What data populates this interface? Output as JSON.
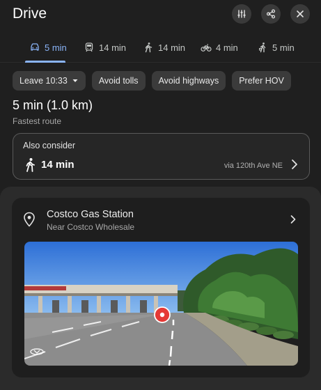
{
  "header": {
    "title": "Drive",
    "buttons": [
      {
        "icon": "tune-icon",
        "label": "Route options"
      },
      {
        "icon": "share-icon",
        "label": "Share"
      },
      {
        "icon": "close-icon",
        "label": "Close"
      }
    ]
  },
  "modes": [
    {
      "icon": "car-icon",
      "label": "5 min",
      "active": true
    },
    {
      "icon": "transit-icon",
      "label": "14 min",
      "active": false
    },
    {
      "icon": "walk-icon",
      "label": "14 min",
      "active": false
    },
    {
      "icon": "bike-icon",
      "label": "4 min",
      "active": false
    },
    {
      "icon": "rideshare-icon",
      "label": "5 min",
      "active": false
    }
  ],
  "chips": {
    "leave": "Leave 10:33",
    "avoid_tolls": "Avoid tolls",
    "avoid_highways": "Avoid highways",
    "prefer_hov": "Prefer HOV"
  },
  "route": {
    "time_distance": "5 min (1.0 km)",
    "description": "Fastest route"
  },
  "also_consider": {
    "title": "Also consider",
    "mode_icon": "walk-icon",
    "time": "14 min",
    "via": "via 120th Ave NE"
  },
  "place": {
    "name": "Costco Gas Station",
    "subtitle": "Near Costco Wholesale"
  },
  "colors": {
    "accent": "#8ab4f8",
    "background": "#1f1f1f",
    "panel": "#2b2b2b",
    "card": "#1e1e1e",
    "chip": "#3b3b3b",
    "marker": "#e53935"
  }
}
